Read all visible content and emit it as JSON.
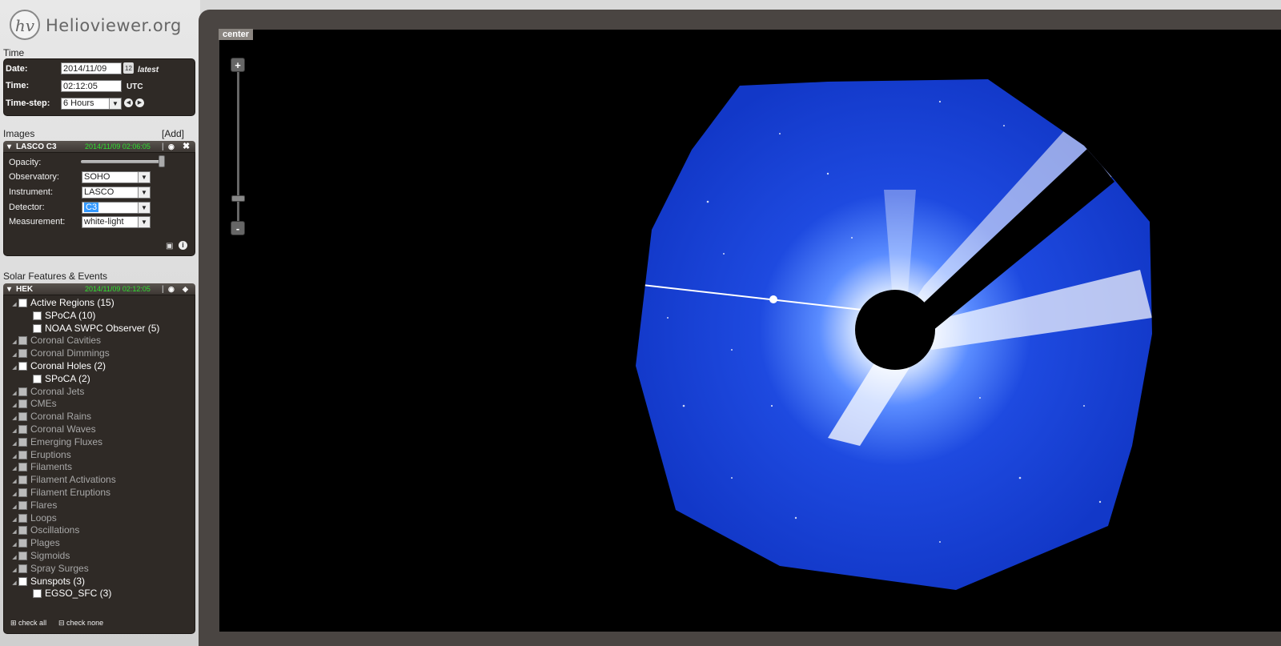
{
  "header": {
    "logo_glyph": "hv",
    "site_name": "Helioviewer.org"
  },
  "time": {
    "section_title": "Time",
    "date_label": "Date:",
    "date_value": "2014/11/09",
    "calendar_glyph": "12",
    "latest_label": "latest",
    "time_label": "Time:",
    "time_value": "02:12:05",
    "utc_label": "UTC",
    "timestep_label": "Time-step:",
    "timestep_value": "6 Hours",
    "back_glyph": "◀",
    "forward_glyph": "▶"
  },
  "images": {
    "section_title": "Images",
    "add_label": "[Add]",
    "layer_name": "LASCO C3",
    "layer_time": "2014/11/09 02:06:05",
    "opacity_label": "Opacity:",
    "opacity_value": 1.0,
    "observatory_label": "Observatory:",
    "observatory_value": "SOHO",
    "instrument_label": "Instrument:",
    "instrument_value": "LASCO",
    "detector_label": "Detector:",
    "detector_value": "C3",
    "measurement_label": "Measurement:",
    "measurement_value": "white-light"
  },
  "features": {
    "section_title": "Solar Features & Events",
    "layer_name": "HEK",
    "layer_time": "2014/11/09 02:12:05",
    "items": [
      {
        "label": "Active Regions (15)",
        "state": "on",
        "indent": 0
      },
      {
        "label": "SPoCA (10)",
        "state": "on",
        "indent": 1
      },
      {
        "label": "NOAA SWPC Observer (5)",
        "state": "on",
        "indent": 1
      },
      {
        "label": "Coronal Cavities",
        "state": "dim",
        "indent": 0
      },
      {
        "label": "Coronal Dimmings",
        "state": "dim",
        "indent": 0
      },
      {
        "label": "Coronal Holes (2)",
        "state": "on",
        "indent": 0
      },
      {
        "label": "SPoCA (2)",
        "state": "on",
        "indent": 1
      },
      {
        "label": "Coronal Jets",
        "state": "dim",
        "indent": 0
      },
      {
        "label": "CMEs",
        "state": "dim",
        "indent": 0
      },
      {
        "label": "Coronal Rains",
        "state": "dim",
        "indent": 0
      },
      {
        "label": "Coronal Waves",
        "state": "dim",
        "indent": 0
      },
      {
        "label": "Emerging Fluxes",
        "state": "dim",
        "indent": 0
      },
      {
        "label": "Eruptions",
        "state": "dim",
        "indent": 0
      },
      {
        "label": "Filaments",
        "state": "dim",
        "indent": 0
      },
      {
        "label": "Filament Activations",
        "state": "dim",
        "indent": 0
      },
      {
        "label": "Filament Eruptions",
        "state": "dim",
        "indent": 0
      },
      {
        "label": "Flares",
        "state": "dim",
        "indent": 0
      },
      {
        "label": "Loops",
        "state": "dim",
        "indent": 0
      },
      {
        "label": "Oscillations",
        "state": "dim",
        "indent": 0
      },
      {
        "label": "Plages",
        "state": "dim",
        "indent": 0
      },
      {
        "label": "Sigmoids",
        "state": "dim",
        "indent": 0
      },
      {
        "label": "Spray Surges",
        "state": "dim",
        "indent": 0
      },
      {
        "label": "Sunspots (3)",
        "state": "on",
        "indent": 0
      },
      {
        "label": "EGSO_SFC (3)",
        "state": "on",
        "indent": 1
      }
    ],
    "check_all_label": "check all",
    "check_none_label": "check none"
  },
  "viewport": {
    "center_label": "center",
    "zoom_in_glyph": "+",
    "zoom_out_glyph": "-"
  },
  "colors": {
    "panel_bg": "#2f2a26",
    "timestamp_green": "#2fe02f",
    "coronagraph_blue": "#1a3fd6",
    "viewport_bg": "#000000"
  }
}
